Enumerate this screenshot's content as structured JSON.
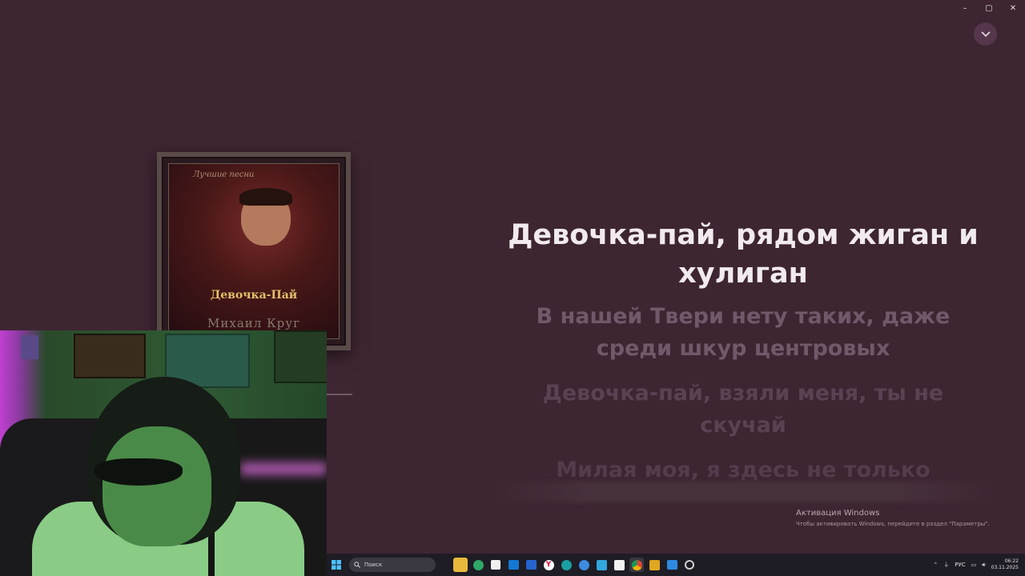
{
  "window": {
    "controls": {
      "minimize_icon": "–",
      "maximize_icon": "▢",
      "close_icon": "✕"
    },
    "collapse_icon": "chevron-down"
  },
  "album": {
    "script_text": "Лучшие песни",
    "title": "Девочка-Пай",
    "artist": "Михаил Круг"
  },
  "lyrics": {
    "current": "Девочка-пай, рядом жиган и хулиган",
    "next": "В нашей Твери нету таких, даже среди шкур центровых",
    "after": "Девочка-пай, взяли меня, ты не скучай",
    "later": "Милая моя, я здесь не только"
  },
  "activation": {
    "title": "Активация Windows",
    "subtitle": "Чтобы активировать Windows, перейдите в раздел \"Параметры\"."
  },
  "taskbar": {
    "search_placeholder": "Поиск",
    "apps": [
      "file-explorer-icon",
      "edge-icon",
      "store-icon",
      "outlook-icon",
      "todo-icon",
      "yandex-icon",
      "edge-dev-icon",
      "chat-icon",
      "mail-icon",
      "capcut-icon",
      "chrome-icon",
      "winamp-icon",
      "photos-icon",
      "settings-icon"
    ],
    "tray": {
      "language": "РУС",
      "time": "06:22",
      "date": "03.11.2025"
    }
  },
  "colors": {
    "background": "#3e2532",
    "lyric_active": "#f1eaee",
    "lyric_inactive": "#71596a",
    "taskbar": "#1e1c24"
  }
}
